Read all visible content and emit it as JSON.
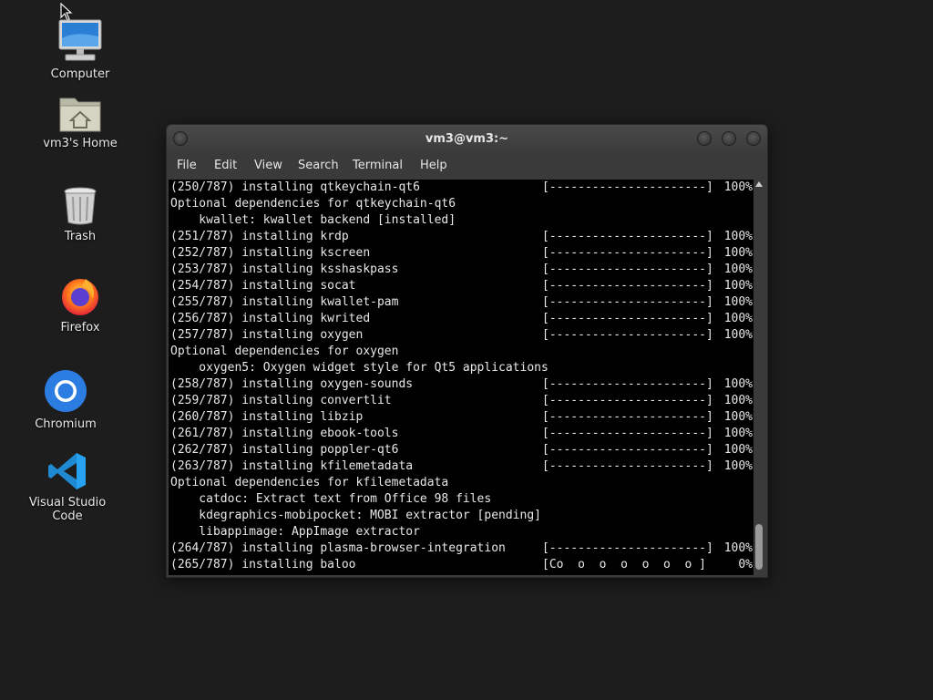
{
  "desktop": {
    "icons": [
      {
        "label": "Computer",
        "icon": "computer-icon"
      },
      {
        "label": "vm3's Home",
        "icon": "home-folder-icon"
      },
      {
        "label": "Trash",
        "icon": "trash-icon"
      },
      {
        "label": "Firefox",
        "icon": "firefox-icon"
      },
      {
        "label": "Chromium",
        "icon": "chromium-icon"
      },
      {
        "label": "Visual Studio Code",
        "icon": "vscode-icon"
      }
    ]
  },
  "window": {
    "title": "vm3@vm3:~",
    "menu": [
      "File",
      "Edit",
      "View",
      "Search",
      "Terminal",
      "Help"
    ]
  },
  "terminal": {
    "lines": [
      {
        "text": "(250/787) installing qtkeychain-qt6",
        "bar": "[----------------------]",
        "pct": "100%"
      },
      {
        "text": "Optional dependencies for qtkeychain-qt6",
        "bar": "",
        "pct": ""
      },
      {
        "text": "    kwallet: kwallet backend [installed]",
        "bar": "",
        "pct": ""
      },
      {
        "text": "(251/787) installing krdp",
        "bar": "[----------------------]",
        "pct": "100%"
      },
      {
        "text": "(252/787) installing kscreen",
        "bar": "[----------------------]",
        "pct": "100%"
      },
      {
        "text": "(253/787) installing ksshaskpass",
        "bar": "[----------------------]",
        "pct": "100%"
      },
      {
        "text": "(254/787) installing socat",
        "bar": "[----------------------]",
        "pct": "100%"
      },
      {
        "text": "(255/787) installing kwallet-pam",
        "bar": "[----------------------]",
        "pct": "100%"
      },
      {
        "text": "(256/787) installing kwrited",
        "bar": "[----------------------]",
        "pct": "100%"
      },
      {
        "text": "(257/787) installing oxygen",
        "bar": "[----------------------]",
        "pct": "100%"
      },
      {
        "text": "Optional dependencies for oxygen",
        "bar": "",
        "pct": ""
      },
      {
        "text": "    oxygen5: Oxygen widget style for Qt5 applications",
        "bar": "",
        "pct": ""
      },
      {
        "text": "(258/787) installing oxygen-sounds",
        "bar": "[----------------------]",
        "pct": "100%"
      },
      {
        "text": "(259/787) installing convertlit",
        "bar": "[----------------------]",
        "pct": "100%"
      },
      {
        "text": "(260/787) installing libzip",
        "bar": "[----------------------]",
        "pct": "100%"
      },
      {
        "text": "(261/787) installing ebook-tools",
        "bar": "[----------------------]",
        "pct": "100%"
      },
      {
        "text": "(262/787) installing poppler-qt6",
        "bar": "[----------------------]",
        "pct": "100%"
      },
      {
        "text": "(263/787) installing kfilemetadata",
        "bar": "[----------------------]",
        "pct": "100%"
      },
      {
        "text": "Optional dependencies for kfilemetadata",
        "bar": "",
        "pct": ""
      },
      {
        "text": "    catdoc: Extract text from Office 98 files",
        "bar": "",
        "pct": ""
      },
      {
        "text": "    kdegraphics-mobipocket: MOBI extractor [pending]",
        "bar": "",
        "pct": ""
      },
      {
        "text": "    libappimage: AppImage extractor",
        "bar": "",
        "pct": ""
      },
      {
        "text": "(264/787) installing plasma-browser-integration",
        "bar": "[----------------------]",
        "pct": "100%"
      },
      {
        "text": "(265/787) installing baloo",
        "bar": "[Co  o  o  o  o  o  o ]",
        "pct": "0%"
      }
    ]
  }
}
